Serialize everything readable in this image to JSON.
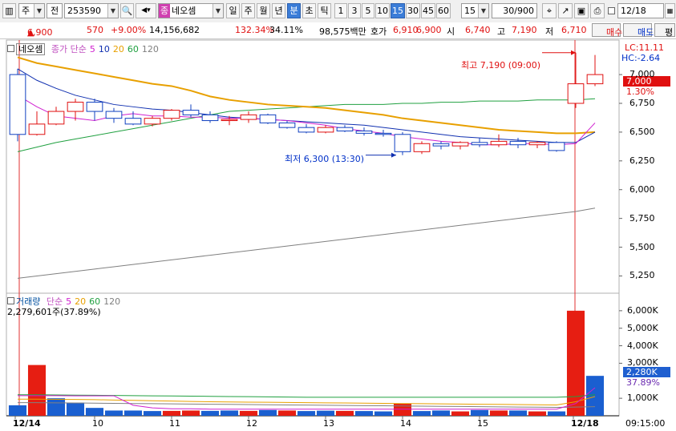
{
  "toolbar": {
    "mode": "주",
    "jeon": "전",
    "code": "253590",
    "name": "네오셈",
    "jong": "종",
    "periods": [
      "일",
      "주",
      "월",
      "년",
      "분",
      "초",
      "틱"
    ],
    "selected_period": "분",
    "minutes": [
      "1",
      "3",
      "5",
      "10",
      "15",
      "30",
      "45",
      "60"
    ],
    "selected_minute": "15",
    "interval_value": "15",
    "count": "30/900",
    "date": "12/18"
  },
  "quote": {
    "price": "6,900",
    "arrow": "▲",
    "change": "570",
    "rate": "+9.00%",
    "volume": "14,156,682",
    "vol_ratio": "132.34%",
    "turnover": "34.11%",
    "amount": "98,575백만",
    "ask_label": "호가",
    "ask": "6,910",
    "bid": "6,900",
    "open_label": "시",
    "open": "6,740",
    "high_label": "고",
    "high": "7,190",
    "low_label": "저",
    "low": "6,710",
    "btn_buy": "매수",
    "btn_sell": "매도",
    "btn_eval": "평"
  },
  "price_panel": {
    "title": "네오셈",
    "legend_prefix": "종가 단순",
    "ma_periods": [
      "5",
      "10",
      "20",
      "60",
      "120"
    ],
    "ma_colors": [
      "#d020d0",
      "#1030b0",
      "#e8a000",
      "#20a040",
      "#808080"
    ],
    "lc": "LC:11.11",
    "hc": "HC:-2.64",
    "current_price_tag": "7,000",
    "current_rate": "1.30%",
    "max_annotation": "최고 7,190 (09:00)",
    "min_annotation": "최저 6,300 (13:30)",
    "ticks": [
      "7,000",
      "6,750",
      "6,500",
      "6,250",
      "6,000",
      "5,750",
      "5,500",
      "5,250"
    ]
  },
  "volume_panel": {
    "title": "거래량",
    "legend_prefix": "단순",
    "ma_periods": [
      "5",
      "20",
      "60",
      "120"
    ],
    "ma_colors": [
      "#d020d0",
      "#e8a000",
      "#20a040",
      "#808080"
    ],
    "info": "2,279,601주(37.89%)",
    "current_tag": "2,280K",
    "current_rate": "37.89%",
    "ticks": [
      "6,000K",
      "5,000K",
      "4,000K",
      "3,000K",
      "1,000K"
    ]
  },
  "x_axis": {
    "labels": [
      "12/14",
      "10",
      "11",
      "12",
      "13",
      "14",
      "15",
      "12/18"
    ],
    "time": "09:15:00"
  },
  "chart_data": {
    "type": "candlestick",
    "interval": "15분",
    "y_range": [
      5100,
      7300
    ],
    "candles": [
      {
        "o": 7000,
        "h": 7050,
        "l": 6420,
        "c": 6480
      },
      {
        "o": 6480,
        "h": 6680,
        "l": 6470,
        "c": 6570
      },
      {
        "o": 6570,
        "h": 6720,
        "l": 6560,
        "c": 6680
      },
      {
        "o": 6680,
        "h": 6790,
        "l": 6600,
        "c": 6760
      },
      {
        "o": 6760,
        "h": 6790,
        "l": 6600,
        "c": 6680
      },
      {
        "o": 6680,
        "h": 6710,
        "l": 6580,
        "c": 6620
      },
      {
        "o": 6620,
        "h": 6680,
        "l": 6560,
        "c": 6570
      },
      {
        "o": 6570,
        "h": 6640,
        "l": 6550,
        "c": 6620
      },
      {
        "o": 6620,
        "h": 6700,
        "l": 6600,
        "c": 6690
      },
      {
        "o": 6690,
        "h": 6740,
        "l": 6630,
        "c": 6650
      },
      {
        "o": 6650,
        "h": 6680,
        "l": 6580,
        "c": 6600
      },
      {
        "o": 6600,
        "h": 6640,
        "l": 6560,
        "c": 6610
      },
      {
        "o": 6610,
        "h": 6680,
        "l": 6580,
        "c": 6650
      },
      {
        "o": 6650,
        "h": 6660,
        "l": 6570,
        "c": 6580
      },
      {
        "o": 6580,
        "h": 6600,
        "l": 6530,
        "c": 6540
      },
      {
        "o": 6540,
        "h": 6570,
        "l": 6490,
        "c": 6500
      },
      {
        "o": 6500,
        "h": 6560,
        "l": 6490,
        "c": 6540
      },
      {
        "o": 6540,
        "h": 6560,
        "l": 6500,
        "c": 6510
      },
      {
        "o": 6510,
        "h": 6540,
        "l": 6470,
        "c": 6490
      },
      {
        "o": 6490,
        "h": 6520,
        "l": 6460,
        "c": 6480
      },
      {
        "o": 6480,
        "h": 6500,
        "l": 6300,
        "c": 6330
      },
      {
        "o": 6330,
        "h": 6420,
        "l": 6310,
        "c": 6400
      },
      {
        "o": 6400,
        "h": 6420,
        "l": 6350,
        "c": 6380
      },
      {
        "o": 6380,
        "h": 6420,
        "l": 6350,
        "c": 6410
      },
      {
        "o": 6410,
        "h": 6450,
        "l": 6370,
        "c": 6390
      },
      {
        "o": 6390,
        "h": 6480,
        "l": 6370,
        "c": 6420
      },
      {
        "o": 6420,
        "h": 6450,
        "l": 6360,
        "c": 6390
      },
      {
        "o": 6390,
        "h": 6420,
        "l": 6360,
        "c": 6410
      },
      {
        "o": 6410,
        "h": 6420,
        "l": 6330,
        "c": 6340
      },
      {
        "o": 6750,
        "h": 7190,
        "l": 6710,
        "c": 6920
      },
      {
        "o": 6920,
        "h": 7170,
        "l": 6900,
        "c": 7000
      }
    ],
    "ma5": [
      6820,
      6720,
      6640,
      6620,
      6600,
      6640,
      6660,
      6640,
      6640,
      6630,
      6630,
      6620,
      6620,
      6610,
      6600,
      6580,
      6560,
      6530,
      6510,
      6490,
      6460,
      6440,
      6420,
      6410,
      6390,
      6390,
      6400,
      6400,
      6390,
      6400,
      6580
    ],
    "ma10": [
      7050,
      6950,
      6880,
      6820,
      6780,
      6740,
      6720,
      6700,
      6690,
      6670,
      6650,
      6630,
      6620,
      6610,
      6600,
      6590,
      6580,
      6570,
      6560,
      6540,
      6520,
      6500,
      6480,
      6460,
      6450,
      6440,
      6430,
      6420,
      6410,
      6410,
      6500
    ],
    "ma20": [
      7150,
      7100,
      7070,
      7040,
      7010,
      6980,
      6950,
      6920,
      6900,
      6860,
      6810,
      6780,
      6760,
      6740,
      6730,
      6720,
      6710,
      6690,
      6670,
      6650,
      6620,
      6600,
      6580,
      6560,
      6540,
      6520,
      6510,
      6500,
      6490,
      6490,
      6500
    ],
    "ma60": [
      6330,
      6370,
      6410,
      6440,
      6470,
      6500,
      6530,
      6560,
      6590,
      6620,
      6650,
      6680,
      6690,
      6700,
      6710,
      6720,
      6730,
      6740,
      6740,
      6740,
      6750,
      6750,
      6760,
      6760,
      6770,
      6770,
      6770,
      6780,
      6780,
      6780,
      6790
    ],
    "ma120": [
      5230,
      5250,
      5270,
      5290,
      5310,
      5330,
      5350,
      5370,
      5390,
      5410,
      5430,
      5450,
      5470,
      5490,
      5510,
      5530,
      5550,
      5570,
      5590,
      5610,
      5630,
      5650,
      5670,
      5690,
      5710,
      5730,
      5750,
      5770,
      5790,
      5810,
      5840
    ],
    "volume_max": 7000,
    "volumes": [
      600,
      2900,
      1000,
      750,
      450,
      300,
      300,
      270,
      280,
      300,
      280,
      300,
      280,
      330,
      300,
      270,
      290,
      280,
      270,
      250,
      700,
      270,
      300,
      250,
      330,
      300,
      300,
      250,
      250,
      6000,
      2280
    ],
    "volume_up": [
      false,
      true,
      false,
      false,
      false,
      false,
      false,
      false,
      true,
      true,
      false,
      false,
      true,
      false,
      true,
      false,
      false,
      true,
      false,
      false,
      true,
      false,
      false,
      true,
      false,
      true,
      false,
      true,
      false,
      true,
      false
    ],
    "vma5": [
      1150,
      1150,
      1150,
      1140,
      1140,
      1140,
      600,
      450,
      400,
      400,
      380,
      380,
      380,
      380,
      380,
      380,
      380,
      380,
      380,
      380,
      380,
      380,
      380,
      380,
      380,
      380,
      380,
      380,
      380,
      700,
      1600
    ],
    "vma20": [
      950,
      950,
      940,
      930,
      920,
      900,
      880,
      860,
      840,
      820,
      800,
      790,
      780,
      770,
      760,
      750,
      740,
      730,
      720,
      710,
      700,
      690,
      680,
      670,
      660,
      650,
      640,
      630,
      620,
      800,
      1100
    ],
    "vma60": [
      1200,
      1200,
      1190,
      1180,
      1170,
      1160,
      1150,
      1140,
      1130,
      1120,
      1110,
      1100,
      1090,
      1080,
      1070,
      1060,
      1060,
      1060,
      1060,
      1060,
      1060,
      1060,
      1060,
      1060,
      1060,
      1060,
      1060,
      1060,
      1060,
      1100,
      1200
    ],
    "vma120": [
      750,
      750,
      740,
      730,
      720,
      710,
      700,
      690,
      680,
      670,
      660,
      650,
      640,
      630,
      620,
      610,
      600,
      590,
      580,
      570,
      560,
      550,
      540,
      530,
      520,
      510,
      500,
      490,
      480,
      500,
      520
    ]
  }
}
